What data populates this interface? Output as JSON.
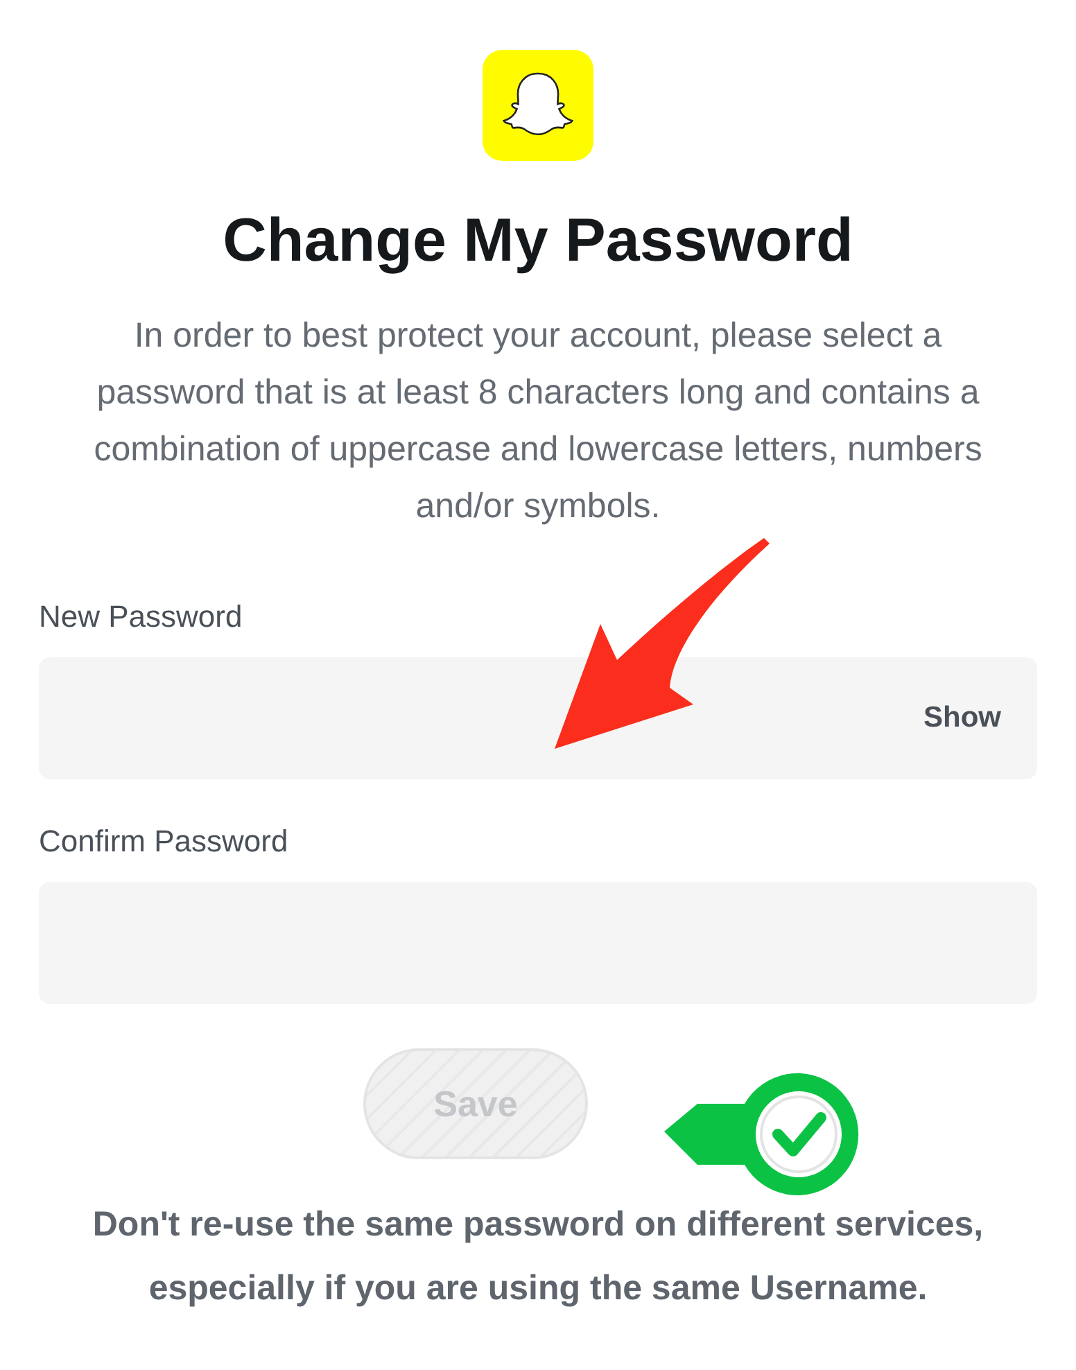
{
  "title": "Change My Password",
  "description": "In order to best protect your account, please select a password that is at least 8 characters long and contains a combination of uppercase and lowercase letters, numbers and/or symbols.",
  "fields": [
    {
      "label": "New Password",
      "toggle": "Show"
    },
    {
      "label": "Confirm Password"
    }
  ],
  "save_button": {
    "label": "Save",
    "disabled": true
  },
  "note": "Don't re-use the same password on different services, especially if you are using the same Username."
}
